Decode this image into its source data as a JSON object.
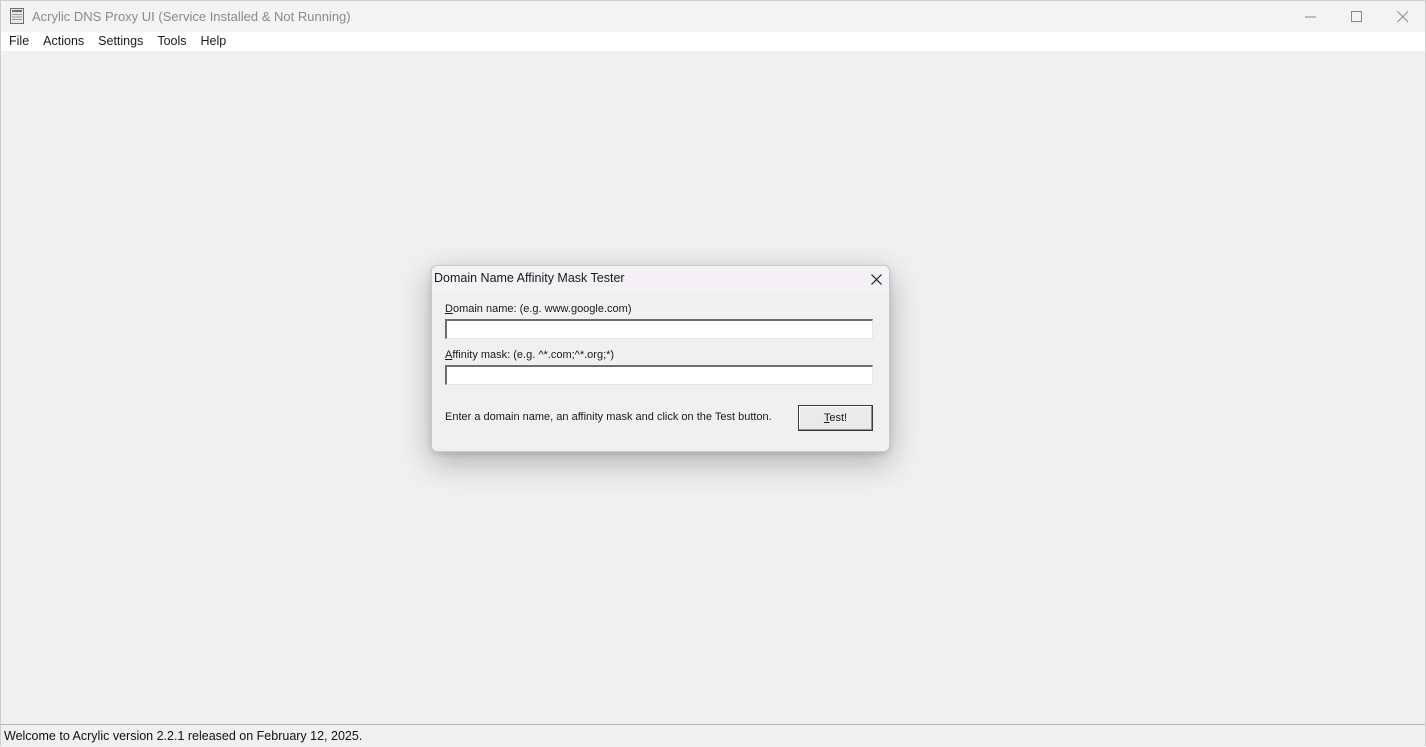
{
  "window": {
    "title": "Acrylic DNS Proxy UI (Service Installed & Not Running)",
    "icon": "app-window-icon"
  },
  "menubar": {
    "items": [
      {
        "label": "File"
      },
      {
        "label": "Actions"
      },
      {
        "label": "Settings"
      },
      {
        "label": "Tools"
      },
      {
        "label": "Help"
      }
    ]
  },
  "dialog": {
    "title": "Domain Name Affinity Mask Tester",
    "domain_label_accel": "D",
    "domain_label_rest": "omain name: (e.g. www.google.com)",
    "domain_value": "",
    "affinity_label_accel": "A",
    "affinity_label_rest": "ffinity mask: (e.g. ^*.com;^*.org;*)",
    "affinity_value": "",
    "hint": "Enter a domain name, an affinity mask and click on the Test button.",
    "test_accel": "T",
    "test_rest": "est!"
  },
  "statusbar": {
    "text": "Welcome to Acrylic version 2.2.1 released on February 12, 2025."
  }
}
